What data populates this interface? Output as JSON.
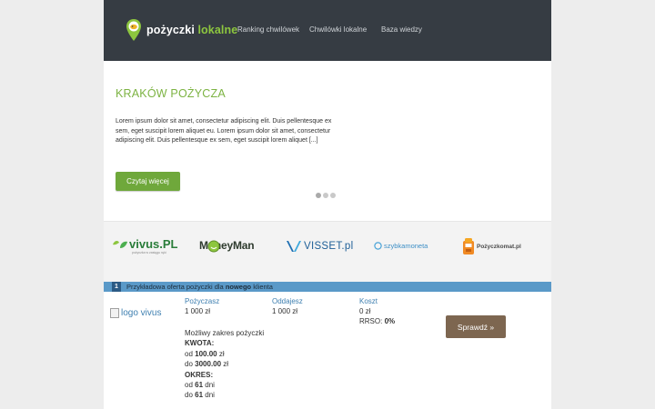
{
  "header": {
    "logo_brand": "pożyczki",
    "logo_accent": "lokalne",
    "nav": [
      "Ranking chwilówek",
      "Chwilówki lokalne",
      "Baza wiedzy"
    ]
  },
  "hero": {
    "title": "KRAKÓW POŻYCZA",
    "text": "Lorem ipsum dolor sit amet, consectetur adipiscing elit. Duis pellentesque ex sem, eget suscipit lorem aliquet eu. Lorem ipsum dolor sit amet, consectetur adipiscing elit. Duis pellentesque ex sem, eget suscipit lorem aliquet [...]",
    "button": "Czytaj więcej",
    "slides": 3,
    "active_slide": 1
  },
  "partners": [
    {
      "name": "vivus.PL",
      "tagline": "pożyczka w zasięgu ręki",
      "icon": "vivus-leaf-icon"
    },
    {
      "name": "MoneyMan",
      "icon": "moneyman-smile-icon"
    },
    {
      "name": "VISSET.pl",
      "icon": "visset-v-icon"
    },
    {
      "name": "szybkamoneta",
      "icon": "coin-icon"
    },
    {
      "name": "Pożyczkomat.pl",
      "icon": "pozyczkomat-robot-icon"
    }
  ],
  "offer": {
    "number": "1",
    "bar_text_prefix": "Przykładowa oferta pożyczki dla ",
    "bar_text_bold": "nowego",
    "bar_text_suffix": " klienta",
    "logo_alt": "logo vivus",
    "borrow_label": "Pożyczasz",
    "borrow_value": "1 000 zł",
    "repay_label": "Oddajesz",
    "repay_value": "1 000 zł",
    "cost_label": "Koszt",
    "cost_value": "0 zł",
    "rrso_label": "RRSO:",
    "rrso_value": "0%",
    "range_title": "Możliwy zakres pożyczki",
    "amount_label": "KWOTA:",
    "amount_from_prefix": "od",
    "amount_from": "100.00",
    "amount_to_prefix": "do",
    "amount_to": "3000.00",
    "currency": "zł",
    "period_label": "OKRES:",
    "period_from_prefix": "od",
    "period_from": "61",
    "period_to_prefix": "do",
    "period_to": "61",
    "days": "dni",
    "button": "Sprawdź »"
  },
  "colors": {
    "header_bg": "#363c43",
    "accent_green": "#7cb342",
    "offer_bar": "#5a99c8",
    "check_button": "#7d6650"
  }
}
